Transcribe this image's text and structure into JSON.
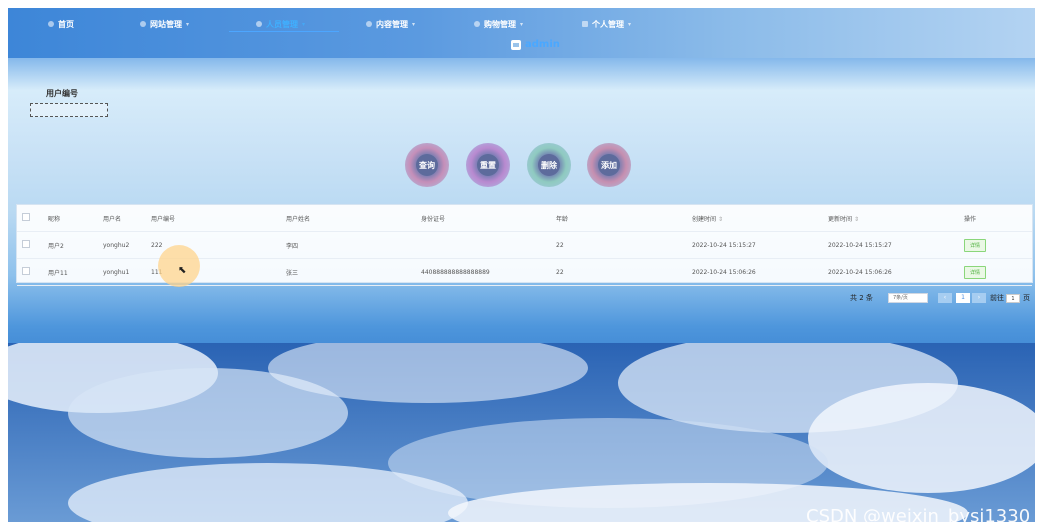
{
  "nav": {
    "items": [
      {
        "label": "首页",
        "active": false,
        "has_caret": false
      },
      {
        "label": "网站管理",
        "active": false,
        "has_caret": true
      },
      {
        "label": "人员管理",
        "active": true,
        "has_caret": true
      },
      {
        "label": "内容管理",
        "active": false,
        "has_caret": true
      },
      {
        "label": "购物管理",
        "active": false,
        "has_caret": true
      },
      {
        "label": "个人管理",
        "active": false,
        "has_caret": true
      }
    ],
    "user": "admin"
  },
  "search": {
    "label": "用户编号",
    "value": ""
  },
  "buttons": {
    "query": "查询",
    "reset": "重置",
    "delete": "删除",
    "add": "添加"
  },
  "table": {
    "headers": [
      "昵称",
      "用户名",
      "用户编号",
      "用户姓名",
      "身份证号",
      "年龄",
      "创建时间",
      "更新时间",
      "操作"
    ],
    "rows": [
      {
        "nickname": "用户2",
        "username": "yonghu2",
        "user_id": "222",
        "name": "李四",
        "id_card": "",
        "age": "22",
        "created": "2022-10-24 15:15:27",
        "updated": "2022-10-24 15:15:27",
        "action": "详情"
      },
      {
        "nickname": "用户11",
        "username": "yonghu1",
        "user_id": "111",
        "name": "张三",
        "id_card": "440888888888888889",
        "age": "22",
        "created": "2022-10-24 15:06:26",
        "updated": "2022-10-24 15:06:26",
        "action": "详情"
      }
    ]
  },
  "pagination": {
    "total": "共 2 条",
    "page_size": "7条/页",
    "prev": "‹",
    "current": "1",
    "next": "›",
    "goto_prefix": "前往",
    "goto_value": "1",
    "goto_suffix": "页"
  },
  "watermark": "CSDN @weixin_bysj1330",
  "colors": {
    "accent": "#3fb0ff",
    "detail_green": "#4caf3c"
  }
}
